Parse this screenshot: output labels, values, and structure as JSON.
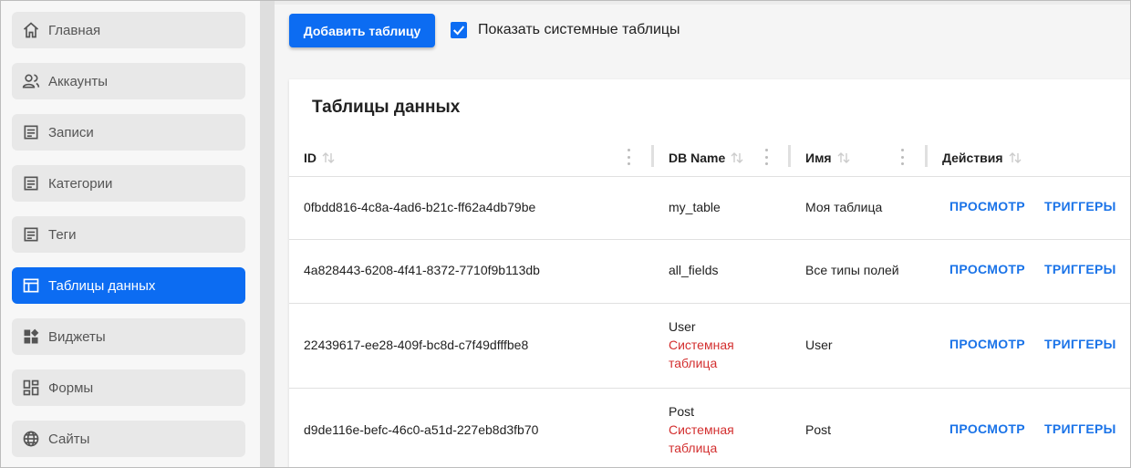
{
  "sidebar": {
    "items": [
      {
        "label": "Главная",
        "icon": "home-icon"
      },
      {
        "label": "Аккаунты",
        "icon": "users-icon"
      },
      {
        "label": "Записи",
        "icon": "document-icon"
      },
      {
        "label": "Категории",
        "icon": "document-icon"
      },
      {
        "label": "Теги",
        "icon": "document-icon"
      },
      {
        "label": "Таблицы данных",
        "icon": "table-icon",
        "active": true
      },
      {
        "label": "Виджеты",
        "icon": "widgets-icon"
      },
      {
        "label": "Формы",
        "icon": "forms-icon"
      },
      {
        "label": "Сайты",
        "icon": "globe-icon"
      }
    ]
  },
  "toolbar": {
    "add_label": "Добавить таблицу",
    "show_system_label": "Показать системные таблицы",
    "show_system_checked": true
  },
  "table": {
    "title": "Таблицы данных",
    "columns": [
      "ID",
      "DB Name",
      "Имя",
      "Действия"
    ],
    "rows": [
      {
        "id": "0fbdd816-4c8a-4ad6-b21c-ff62a4db79be",
        "db_name": "my_table",
        "system_line1": "",
        "system_line2": "",
        "name": "Моя таблица",
        "view": "ПРОСМОТР",
        "triggers": "ТРИГГЕРЫ"
      },
      {
        "id": "4a828443-6208-4f41-8372-7710f9b113db",
        "db_name": "all_fields",
        "system_line1": "",
        "system_line2": "",
        "name": "Все типы полей",
        "view": "ПРОСМОТР",
        "triggers": "ТРИГГЕРЫ"
      },
      {
        "id": "22439617-ee28-409f-bc8d-c7f49dfffbe8",
        "db_name": "User",
        "system_line1": "Системная",
        "system_line2": "таблица",
        "name": "User",
        "view": "ПРОСМОТР",
        "triggers": "ТРИГГЕРЫ"
      },
      {
        "id": "d9de116e-befc-46c0-a51d-227eb8d3fb70",
        "db_name": "Post",
        "system_line1": "Системная",
        "system_line2": "таблица",
        "name": "Post",
        "view": "ПРОСМОТР",
        "triggers": "ТРИГГЕРЫ"
      }
    ]
  },
  "colors": {
    "accent": "#0c6cf2",
    "action": "#1a73e8",
    "system_tag": "#d32f2f"
  }
}
